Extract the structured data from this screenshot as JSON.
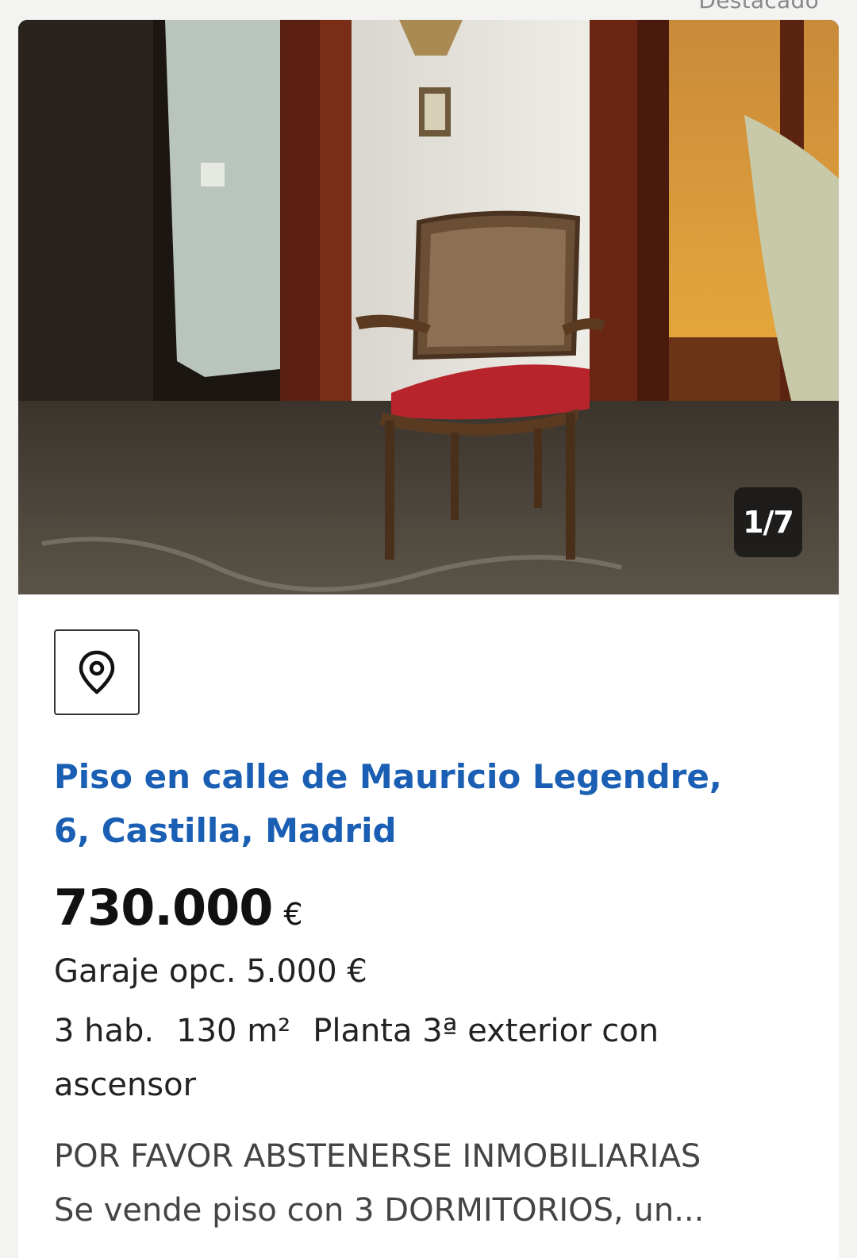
{
  "top_badge": "Destacado",
  "listing": {
    "photo_counter": "1/7",
    "title": "Piso en calle de Mauricio Legendre, 6, Castilla, Madrid",
    "price": "730.000",
    "currency": "€",
    "garage": "Garaje opc. 5.000 €",
    "features": {
      "rooms": "3 hab.",
      "area": "130 m²",
      "floor": "Planta 3ª exterior con ascensor"
    },
    "description_line1": "POR FAVOR ABSTENERSE INMOBILIARIAS",
    "description_line2": "Se vende piso con 3 DORMITORIOS, un..."
  },
  "colors": {
    "title_blue": "#1a5fb4",
    "chair_seat": "#b8242c"
  },
  "icons": {
    "map": "map-pin-icon"
  }
}
